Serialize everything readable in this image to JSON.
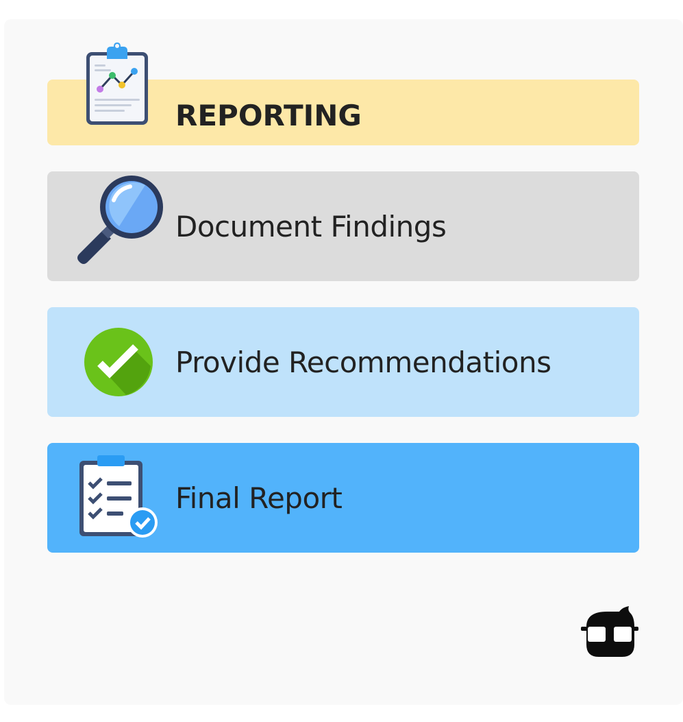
{
  "colors": {
    "background": "#f9f9f9",
    "title_band": "#fde8a8",
    "step1_band": "#dcdcdc",
    "step2_band": "#bfe2fb",
    "step3_band": "#52b3fb",
    "text": "#222222"
  },
  "header": {
    "title": "REPORTING",
    "icon": "clipboard-chart-icon"
  },
  "steps": [
    {
      "label": "Document Findings",
      "icon": "magnifying-glass-icon"
    },
    {
      "label": "Provide Recommendations",
      "icon": "check-circle-icon"
    },
    {
      "label": "Final Report",
      "icon": "checklist-clipboard-icon"
    }
  ],
  "footer": {
    "icon": "mascot-logo-icon"
  }
}
